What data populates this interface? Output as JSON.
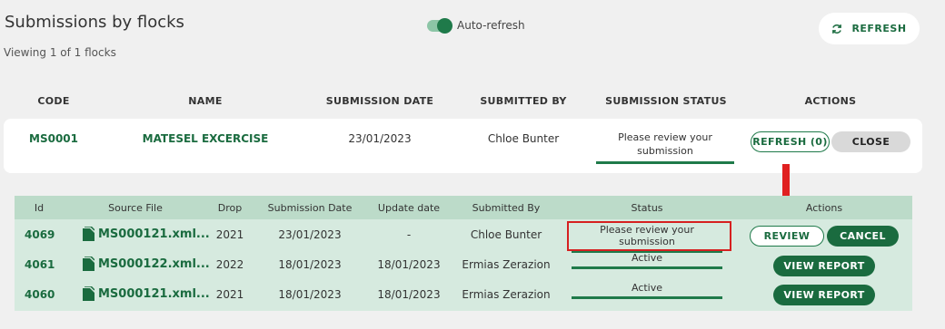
{
  "page": {
    "title": "Submissions by flocks",
    "subtitle": "Viewing 1 of 1 flocks",
    "auto_refresh_label": "Auto-refresh",
    "refresh_button": "REFRESH"
  },
  "flock_table": {
    "headers": [
      "CODE",
      "NAME",
      "SUBMISSION DATE",
      "SUBMITTED BY",
      "SUBMISSION STATUS",
      "ACTIONS"
    ],
    "row": {
      "code": "MS0001",
      "name": "MATESEL EXCERCISE",
      "date": "23/01/2023",
      "submitted_by": "Chloe Bunter",
      "status_line1": "Please review your",
      "status_line2": "submission",
      "refresh_label": "REFRESH (0)",
      "close_label": "CLOSE"
    }
  },
  "submissions_table": {
    "headers": [
      "Id",
      "Source File",
      "Drop",
      "Submission Date",
      "Update date",
      "Submitted By",
      "Status",
      "Actions"
    ],
    "rows": [
      {
        "id": "4069",
        "file": "MS000121.xml...",
        "drop": "2021",
        "submission_date": "23/01/2023",
        "update_date": "-",
        "submitted_by": "Chloe Bunter",
        "status": "Please review your submission",
        "action1": "REVIEW",
        "action2": "CANCEL"
      },
      {
        "id": "4061",
        "file": "MS000122.xml...",
        "drop": "2022",
        "submission_date": "18/01/2023",
        "update_date": "18/01/2023",
        "submitted_by": "Ermias Zerazion",
        "status": "Active",
        "action1": "VIEW REPORT"
      },
      {
        "id": "4060",
        "file": "MS000121.xml...",
        "drop": "2021",
        "submission_date": "18/01/2023",
        "update_date": "18/01/2023",
        "submitted_by": "Ermias Zerazion",
        "status": "Active",
        "action1": "VIEW REPORT"
      }
    ]
  },
  "colors": {
    "accent": "#1a6b3f",
    "table_bg": "#d6eadf",
    "table_header_bg": "#bcdbc9",
    "highlight": "#d62020"
  }
}
